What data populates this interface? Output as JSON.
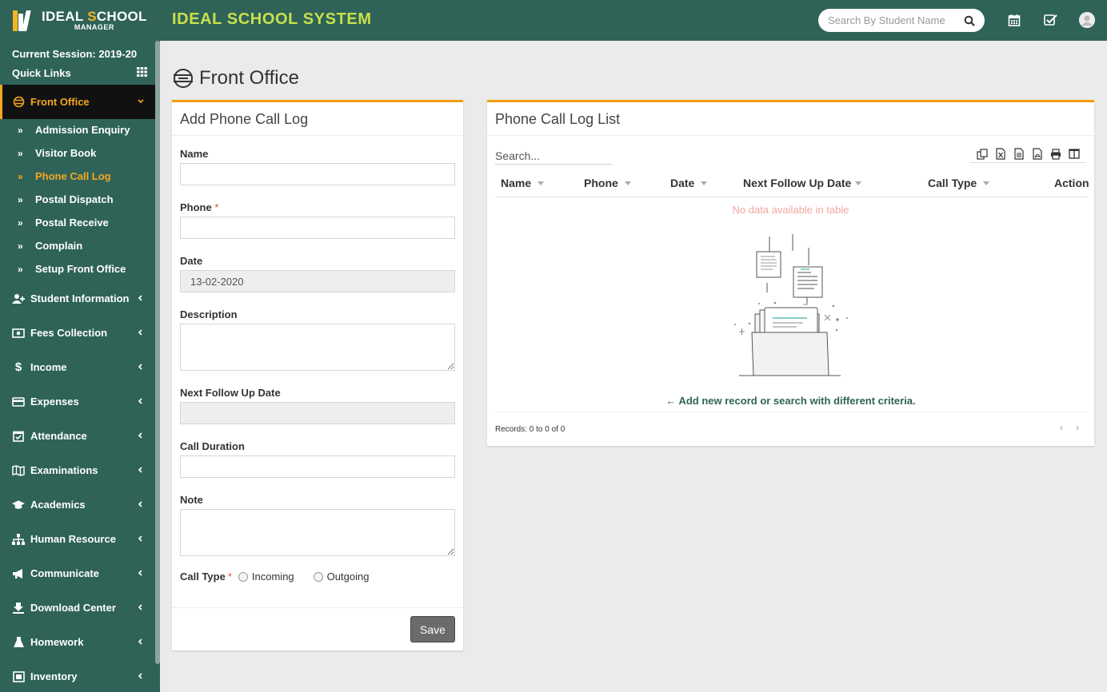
{
  "header": {
    "logo_line1_part1": "IDEAL ",
    "logo_line1_part2": "S",
    "logo_line1_part3": "CHOOL",
    "logo_line2": "MANAGER",
    "app_title": "IDEAL SCHOOL SYSTEM",
    "search_placeholder": "Search By Student Name",
    "icons": [
      "calendar-icon",
      "check-square-icon",
      "user-avatar-icon"
    ]
  },
  "sidebar": {
    "session": "Current Session: 2019-20",
    "quick_links": "Quick Links",
    "active_menu": "Front Office",
    "sub_items": [
      {
        "label": "Admission Enquiry"
      },
      {
        "label": "Visitor Book"
      },
      {
        "label": "Phone Call Log",
        "current": true
      },
      {
        "label": "Postal Dispatch"
      },
      {
        "label": "Postal Receive"
      },
      {
        "label": "Complain"
      },
      {
        "label": "Setup Front Office"
      }
    ],
    "items": [
      {
        "label": "Student Information",
        "icon": "user-plus-icon"
      },
      {
        "label": "Fees Collection",
        "icon": "money-icon"
      },
      {
        "label": "Income",
        "icon": "dollar-icon"
      },
      {
        "label": "Expenses",
        "icon": "credit-card-icon"
      },
      {
        "label": "Attendance",
        "icon": "calendar-check-icon"
      },
      {
        "label": "Examinations",
        "icon": "map-icon"
      },
      {
        "label": "Academics",
        "icon": "graduation-cap-icon"
      },
      {
        "label": "Human Resource",
        "icon": "sitemap-icon"
      },
      {
        "label": "Communicate",
        "icon": "bullhorn-icon"
      },
      {
        "label": "Download Center",
        "icon": "download-icon"
      },
      {
        "label": "Homework",
        "icon": "flask-icon"
      },
      {
        "label": "Inventory",
        "icon": "inventory-icon"
      }
    ]
  },
  "page": {
    "title": "Front Office"
  },
  "form": {
    "title": "Add Phone Call Log",
    "name_label": "Name",
    "phone_label": "Phone",
    "required_mark": "*",
    "date_label": "Date",
    "date_value": "13-02-2020",
    "description_label": "Description",
    "next_follow_label": "Next Follow Up Date",
    "call_duration_label": "Call Duration",
    "note_label": "Note",
    "call_type_label": "Call Type",
    "incoming_label": "Incoming",
    "outgoing_label": "Outgoing",
    "save_label": "Save"
  },
  "list": {
    "title": "Phone Call Log List",
    "search_placeholder": "Search...",
    "toolbar": [
      "copy-icon",
      "excel-icon",
      "csv-icon",
      "pdf-icon",
      "print-icon",
      "columns-icon"
    ],
    "columns": [
      "Name",
      "Phone",
      "Date",
      "Next Follow Up Date",
      "Call Type",
      "Action"
    ],
    "empty_text": "No data available in table",
    "hint_arrow": "←",
    "hint_text": "Add new record or search with different criteria.",
    "records": "Records: 0 to 0 of 0",
    "prev": "‹",
    "next": "›"
  }
}
